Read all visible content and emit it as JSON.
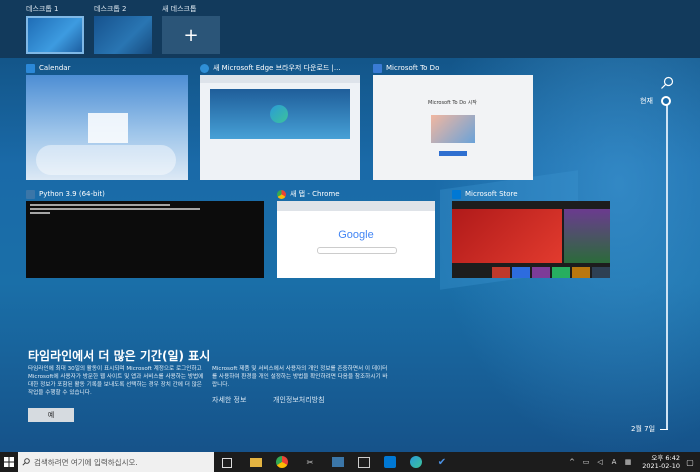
{
  "desktops": [
    {
      "label": "데스크톱 1"
    },
    {
      "label": "데스크톱 2"
    },
    {
      "label": "새 데스크톱"
    }
  ],
  "windows": {
    "calendar": {
      "title": "Calendar"
    },
    "edge": {
      "title": "새 Microsoft Edge 브라우저 다운로드 |..."
    },
    "todo": {
      "title": "Microsoft To Do",
      "content": "Microsoft To Do 시작"
    },
    "python": {
      "title": "Python 3.9 (64-bit)"
    },
    "chrome": {
      "title": "새 탭 - Chrome",
      "content": "Google"
    },
    "store": {
      "title": "Microsoft Store"
    }
  },
  "timeline": {
    "now_label": "현재",
    "date_label": "2월 7일"
  },
  "promo": {
    "title": "타임라인에서 더 많은 기간(일) 표시",
    "text_left": "타임라인에 최대 30일의 활동이 표시되며 Microsoft 계정으로 로그인하고 Microsoft에 사용자가 방문한 웹 사이트 및 앱과 서비스를 사용하는 방법에 대한 정보가 포함된 활동 기록을 보내도록 선택하는 경우 장치 간에 더 많은 작업을 수행할 수 있습니다.",
    "text_right": "Microsoft 제품 및 서비스에서 사용자의 개인 정보를 존중하면서 이 데이터를 사용하여 환경을 개인 설정하는 방법을 확인하려면 다음을 참조하시기 바랍니다.",
    "yes_label": "예",
    "link_more": "자세한 정보",
    "link_privacy": "개인정보처리방침"
  },
  "taskbar": {
    "search_placeholder": "검색하려면 여기에 입력하십시오.",
    "ime": "A",
    "time": "오후 6:42",
    "date": "2021-02-10"
  }
}
